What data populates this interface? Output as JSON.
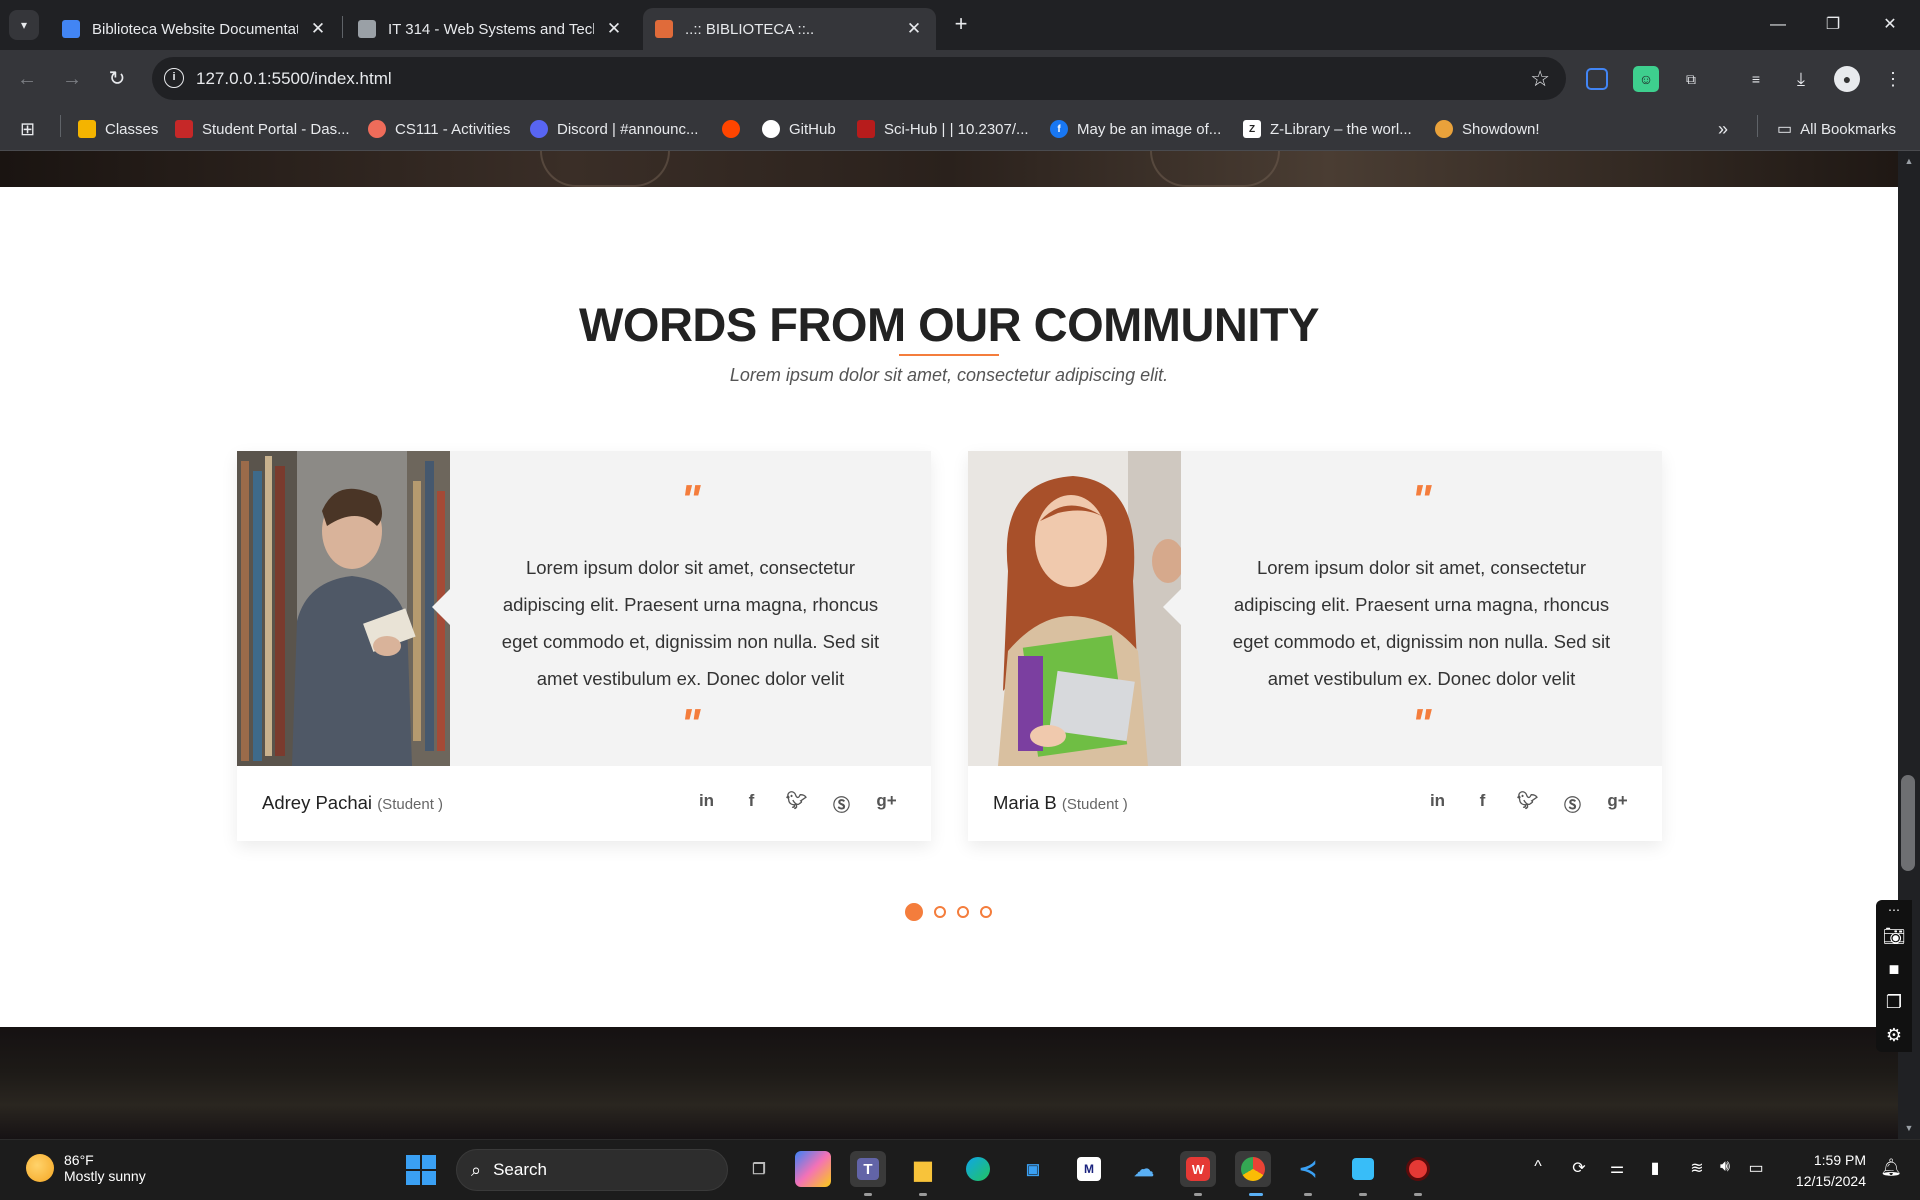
{
  "browser": {
    "tabs": [
      {
        "title": "Biblioteca Website Documentat",
        "favicon_color": "#4285f4"
      },
      {
        "title": "IT 314 - Web Systems and Techn",
        "favicon_color": "#9aa0a6"
      },
      {
        "title": "..:: BIBLIOTECA ::..",
        "favicon_color": "#e06b3a"
      }
    ],
    "address": "127.0.0.1:5500/index.html",
    "bookmarks": [
      {
        "label": "Classes",
        "icon_color": "#f4b400"
      },
      {
        "label": "Student Portal - Das...",
        "icon_color": "#c62828"
      },
      {
        "label": "CS111 - Activities",
        "icon_color": "#ef6c5a"
      },
      {
        "label": "Discord | #announc...",
        "icon_color": "#5865f2"
      },
      {
        "label": "",
        "icon_color": "#ff4500"
      },
      {
        "label": "GitHub",
        "icon_color": "#ffffff"
      },
      {
        "label": "Sci-Hub | | 10.2307/...",
        "icon_color": "#b71c1c"
      },
      {
        "label": "May be an image of...",
        "icon_color": "#1877f2"
      },
      {
        "label": "Z-Library – the worl...",
        "icon_color": "#ffffff"
      },
      {
        "label": "Showdown!",
        "icon_color": "#e9a23b"
      }
    ],
    "all_bookmarks": "All Bookmarks"
  },
  "page": {
    "section_title": "WORDS FROM OUR COMMUNITY",
    "section_subtitle": "Lorem ipsum dolor sit amet, consectetur adipiscing elit.",
    "accent_color": "#f47d3c",
    "testimonials": [
      {
        "quote": "Lorem ipsum dolor sit amet, consectetur adipiscing elit. Praesent urna magna, rhoncus eget commodo et, dignissim non nulla. Sed sit amet vestibulum ex. Donec dolor velit",
        "name": "Adrey Pachai",
        "role": "(Student )",
        "open_quote": "\"",
        "close_quote": "\""
      },
      {
        "quote": "Lorem ipsum dolor sit amet, consectetur adipiscing elit. Praesent urna magna, rhoncus eget commodo et, dignissim non nulla. Sed sit amet vestibulum ex. Donec dolor velit",
        "name": "Maria B",
        "role": "(Student )",
        "open_quote": "\"",
        "close_quote": "\""
      }
    ],
    "social_icons": [
      "linkedin-icon",
      "facebook-icon",
      "twitter-icon",
      "skype-icon",
      "google-plus-icon"
    ],
    "carousel": {
      "count": 4,
      "active": 0
    }
  },
  "taskbar": {
    "weather_temp": "86°F",
    "weather_desc": "Mostly sunny",
    "search_label": "Search",
    "time": "1:59 PM",
    "date": "12/15/2024"
  }
}
